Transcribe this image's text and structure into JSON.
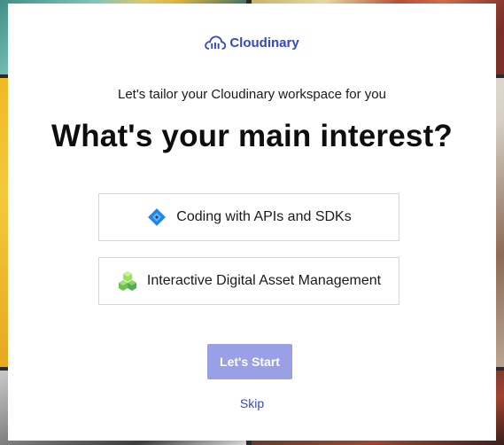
{
  "logo": {
    "text": "Cloudinary",
    "icon": "cloud-icon",
    "color": "#3448c5"
  },
  "subtitle": "Let's tailor your Cloudinary workspace for you",
  "title": "What's your main interest?",
  "options": [
    {
      "label": "Coding with APIs and SDKs",
      "icon": "code-diamond-icon",
      "color": "#1e88e5"
    },
    {
      "label": "Interactive Digital Asset Management",
      "icon": "cubes-icon",
      "color": "#7ed957"
    }
  ],
  "start_button": {
    "label": "Let's Start",
    "color": "#9aa0e6",
    "disabled": true
  },
  "skip_link": {
    "label": "Skip"
  }
}
